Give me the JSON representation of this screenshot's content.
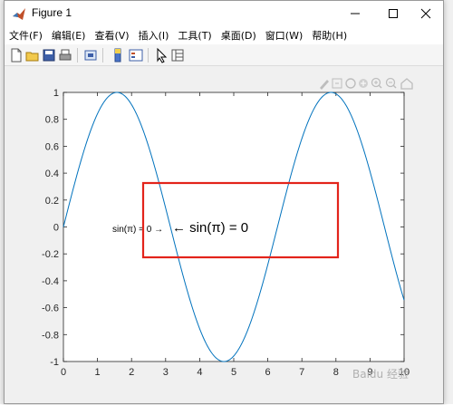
{
  "window": {
    "title": "Figure 1",
    "controls": [
      "minimize-icon",
      "maximize-icon",
      "close-icon"
    ]
  },
  "menu": {
    "items": [
      "文件(F)",
      "编辑(E)",
      "查看(V)",
      "插入(I)",
      "工具(T)",
      "桌面(D)",
      "窗口(W)",
      "帮助(H)"
    ]
  },
  "toolbar": {
    "icons": [
      "new-figure-icon",
      "open-file-icon",
      "save-icon",
      "print-icon",
      "link-plot-icon",
      "insert-colorbar-icon",
      "insert-legend-icon",
      "edit-plot-icon",
      "property-inspector-icon"
    ]
  },
  "axes_toolbar": {
    "icons": [
      "brush-icon",
      "data-tips-icon",
      "rotate-icon",
      "pan-icon",
      "zoom-in-icon",
      "zoom-out-icon",
      "home-icon"
    ]
  },
  "annotations": {
    "small": "sin(π) = 0 →",
    "large": "← sin(π) = 0"
  },
  "watermark": "Baidu 经验",
  "colors": {
    "line": "#0072bd",
    "highlight_box": "#e3241b",
    "axes_bg": "#ffffff"
  },
  "chart_data": {
    "type": "line",
    "series": [
      {
        "function": "sin(x)",
        "x_start": 0,
        "x_end": 10
      }
    ],
    "xlim": [
      0,
      10
    ],
    "ylim": [
      -1,
      1
    ],
    "xticks": [
      "0",
      "1",
      "2",
      "3",
      "4",
      "5",
      "6",
      "7",
      "8",
      "9",
      "10"
    ],
    "yticks": [
      "1",
      "0.8",
      "0.6",
      "0.4",
      "0.2",
      "0",
      "-0.2",
      "-0.4",
      "-0.6",
      "-0.8",
      "-1"
    ],
    "grid": false
  }
}
